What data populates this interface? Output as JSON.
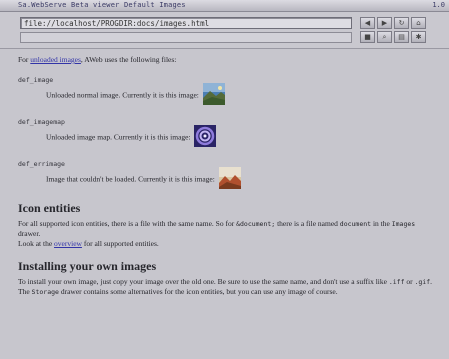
{
  "window": {
    "title": "Sa.WebServe Beta   viewer  Default Images",
    "title_right": "1.0"
  },
  "toolbar": {
    "url": "file://localhost/PROGDIR:docs/images.html",
    "buttons": [
      "back-button",
      "forward-button",
      "reload-button",
      "home-button",
      "stop-button",
      "search-button",
      "print-button",
      "settings-button"
    ]
  },
  "intro": {
    "prefix": "For ",
    "link": "unloaded images",
    "suffix": ", AWeb uses the following files:"
  },
  "files": [
    {
      "name": "def_image",
      "desc": "Unloaded normal image. Currently it is this image:",
      "icon": "landscape-image-icon"
    },
    {
      "name": "def_imagemap",
      "desc": "Unloaded image map. Currently it is this image:",
      "icon": "swirl-image-icon"
    },
    {
      "name": "def_errimage",
      "desc": "Image that couldn't be loaded. Currently it is this image:",
      "icon": "broken-image-icon"
    }
  ],
  "icon_section": {
    "heading": "Icon entities",
    "p1_a": "For all supported icon entities, there is a file with the same name. So for ",
    "p1_code": "&document;",
    "p1_b": " there is a file named ",
    "p1_code2": "document",
    "p1_c": " in the ",
    "p1_code3": "Images",
    "p1_d": " drawer.",
    "p2_a": "Look at the ",
    "p2_link": "overview",
    "p2_b": " for all supported entities."
  },
  "install_section": {
    "heading": "Installing your own images",
    "p1_a": "To install your own image, just copy your image over the old one. Be sure to use the same name, and don't use a suffix like ",
    "p1_code": ".iff",
    "p1_b": " or ",
    "p1_code2": ".gif",
    "p1_c": ".",
    "p2_a": "The ",
    "p2_code": "Storage",
    "p2_b": " drawer contains some alternatives for the icon entities, but you can use any image of course."
  },
  "colors": {
    "background": "#c7c6cd",
    "link": "#3234a8",
    "text": "#26262c"
  }
}
